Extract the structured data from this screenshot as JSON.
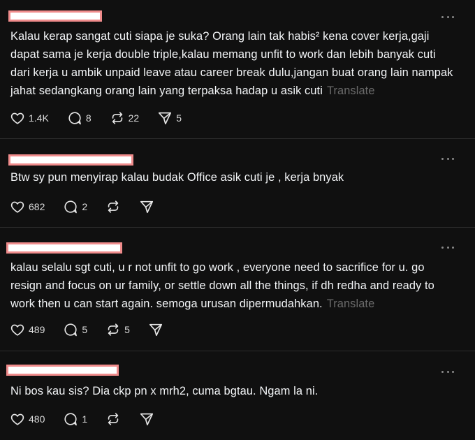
{
  "posts": [
    {
      "text": "Kalau kerap sangat cuti siapa je suka? Orang lain tak habis² kena cover kerja,gaji dapat sama je kerja double triple,kalau memang unfit to work dan lebih banyak cuti dari kerja u ambik unpaid leave atau career break dulu,jangan buat orang lain nampak jahat sedangkang orang lain yang terpaksa hadap u asik cuti",
      "translate": "Translate",
      "likes": "1.4K",
      "replies": "8",
      "reposts": "22",
      "shares": "5"
    },
    {
      "text": "Btw sy pun menyirap kalau budak Office asik cuti je , kerja bnyak",
      "translate": "",
      "likes": "682",
      "replies": "2",
      "reposts": "",
      "shares": ""
    },
    {
      "text": "kalau selalu sgt cuti, u r not unfit to go work , everyone need to sacrifice for u. go resign and focus on ur family, or settle down all the things, if dh redha and ready to work then u can start again. semoga urusan dipermudahkan.",
      "translate": "Translate",
      "likes": "489",
      "replies": "5",
      "reposts": "5",
      "shares": ""
    },
    {
      "text": "Ni bos kau sis? Dia ckp pn x mrh2, cuma bgtau. Ngam la ni.",
      "translate": "",
      "likes": "480",
      "replies": "1",
      "reposts": "",
      "shares": ""
    }
  ]
}
